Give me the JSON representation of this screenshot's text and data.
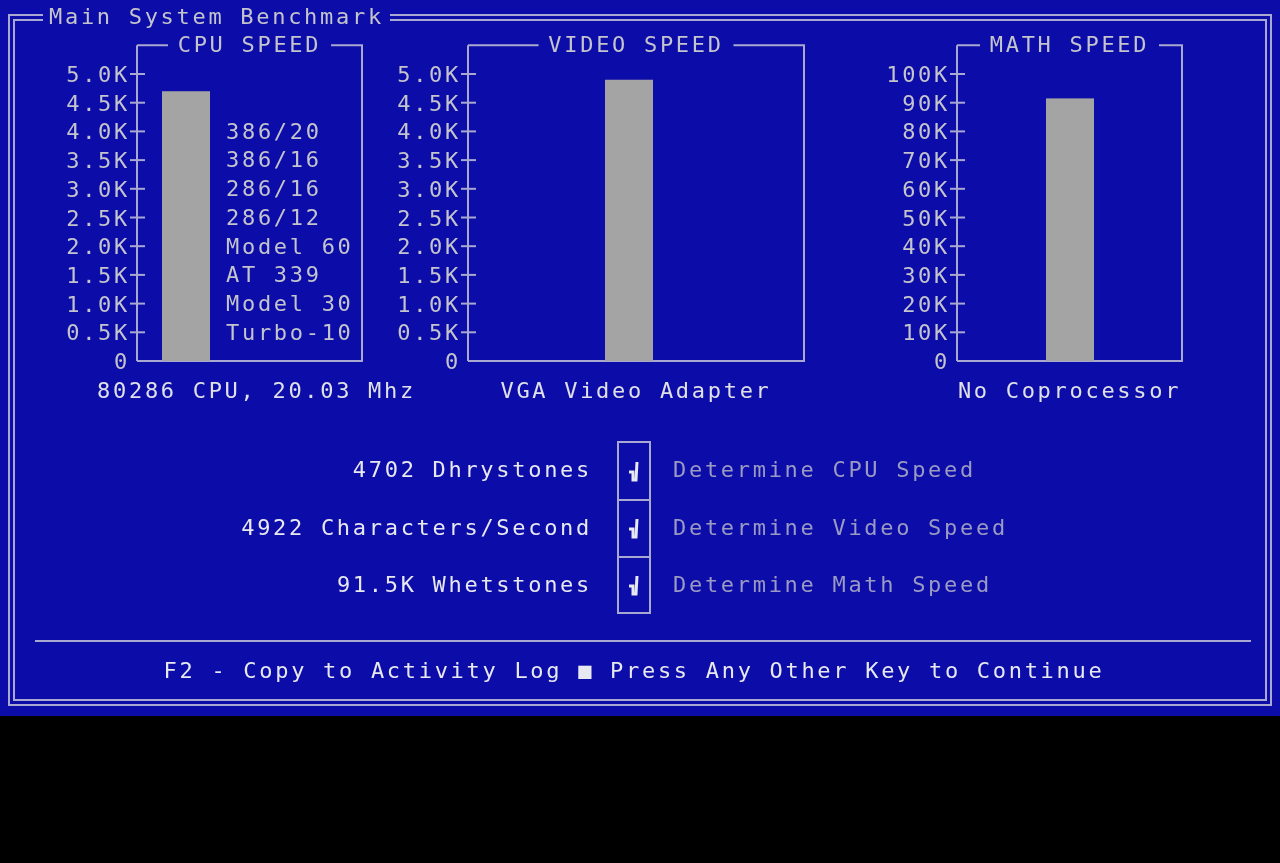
{
  "window": {
    "title": "Main System Benchmark"
  },
  "charts": [
    {
      "caption": "80286 CPU, 20.03 Mhz",
      "reference_labels": [
        "386/20",
        "386/16",
        "286/16",
        "286/12",
        "Model 60",
        "AT 339",
        "Model 30",
        "Turbo-10"
      ],
      "chart_data": {
        "type": "bar",
        "title": "CPU SPEED",
        "values": [
          4700
        ],
        "ylim": [
          0,
          5500
        ],
        "yticks": [
          {
            "value": 0,
            "label": "0"
          },
          {
            "value": 500,
            "label": "0.5K"
          },
          {
            "value": 1000,
            "label": "1.0K"
          },
          {
            "value": 1500,
            "label": "1.5K"
          },
          {
            "value": 2000,
            "label": "2.0K"
          },
          {
            "value": 2500,
            "label": "2.5K"
          },
          {
            "value": 3000,
            "label": "3.0K"
          },
          {
            "value": 3500,
            "label": "3.5K"
          },
          {
            "value": 4000,
            "label": "4.0K"
          },
          {
            "value": 4500,
            "label": "4.5K"
          },
          {
            "value": 5000,
            "label": "5.0K"
          }
        ]
      }
    },
    {
      "caption": "VGA Video Adapter",
      "chart_data": {
        "type": "bar",
        "title": "VIDEO SPEED",
        "values": [
          4900
        ],
        "ylim": [
          0,
          5500
        ],
        "yticks": [
          {
            "value": 0,
            "label": "0"
          },
          {
            "value": 500,
            "label": "0.5K"
          },
          {
            "value": 1000,
            "label": "1.0K"
          },
          {
            "value": 1500,
            "label": "1.5K"
          },
          {
            "value": 2000,
            "label": "2.0K"
          },
          {
            "value": 2500,
            "label": "2.5K"
          },
          {
            "value": 3000,
            "label": "3.0K"
          },
          {
            "value": 3500,
            "label": "3.5K"
          },
          {
            "value": 4000,
            "label": "4.0K"
          },
          {
            "value": 4500,
            "label": "4.5K"
          },
          {
            "value": 5000,
            "label": "5.0K"
          }
        ]
      }
    },
    {
      "caption": "No Coprocessor",
      "chart_data": {
        "type": "bar",
        "title": "MATH SPEED",
        "values": [
          91500
        ],
        "ylim": [
          0,
          110000
        ],
        "yticks": [
          {
            "value": 0,
            "label": "0"
          },
          {
            "value": 10000,
            "label": "10K"
          },
          {
            "value": 20000,
            "label": "20K"
          },
          {
            "value": 30000,
            "label": "30K"
          },
          {
            "value": 40000,
            "label": "40K"
          },
          {
            "value": 50000,
            "label": "50K"
          },
          {
            "value": 60000,
            "label": "60K"
          },
          {
            "value": 70000,
            "label": "70K"
          },
          {
            "value": 80000,
            "label": "80K"
          },
          {
            "value": 90000,
            "label": "90K"
          },
          {
            "value": 100000,
            "label": "100K"
          }
        ]
      }
    }
  ],
  "checks": [
    {
      "result": "4702 Dhrystones",
      "checked": true,
      "label": "Determine CPU Speed"
    },
    {
      "result": "4922 Characters/Second",
      "checked": true,
      "label": "Determine Video Speed"
    },
    {
      "result": "91.5K Whetstones",
      "checked": true,
      "label": "Determine Math Speed"
    }
  ],
  "footer": {
    "text": "F2 - Copy to Activity Log ■ Press Any Other Key to Continue"
  }
}
